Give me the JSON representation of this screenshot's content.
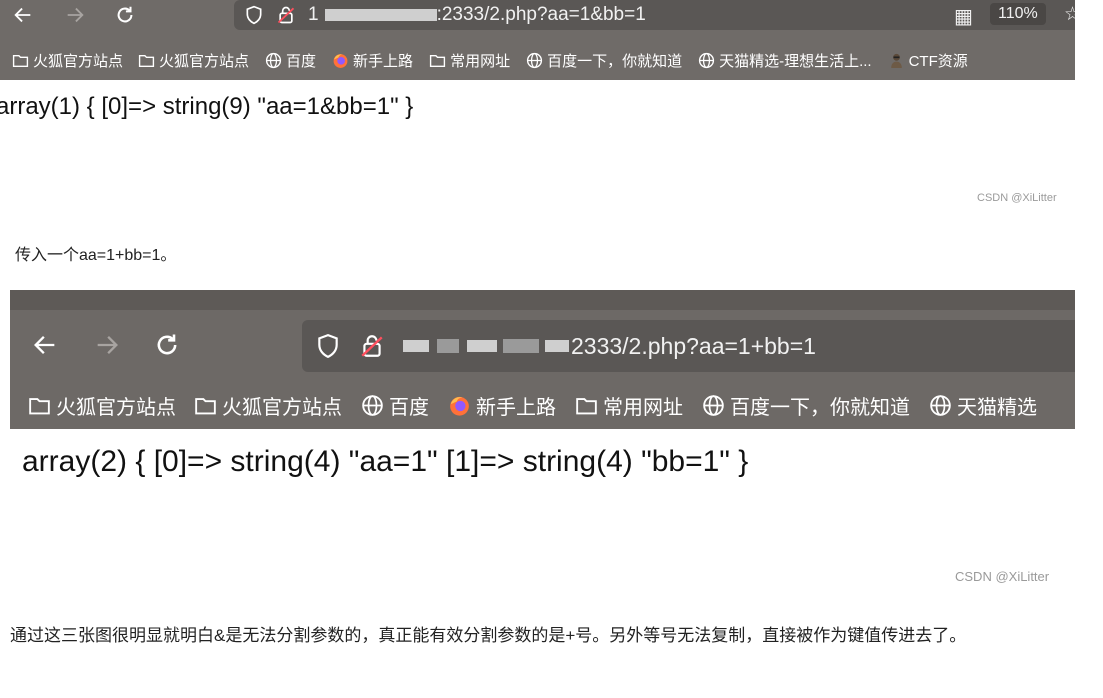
{
  "screenshot1": {
    "url_prefix": "1",
    "url_rest": ":2333/2.php?aa=1&bb=1",
    "zoom": "110%",
    "bookmarks": [
      {
        "icon": "folder-icon",
        "label": "火狐官方站点"
      },
      {
        "icon": "folder-icon",
        "label": "火狐官方站点"
      },
      {
        "icon": "globe-icon",
        "label": "百度"
      },
      {
        "icon": "firefox-icon",
        "label": "新手上路"
      },
      {
        "icon": "folder-icon",
        "label": "常用网址"
      },
      {
        "icon": "globe-icon",
        "label": "百度一下，你就知道"
      },
      {
        "icon": "globe-icon",
        "label": "天猫精选-理想生活上..."
      },
      {
        "icon": "hacker-icon",
        "label": "CTF资源"
      }
    ],
    "output": "array(1) { [0]=> string(9) \"aa=1&bb=1\" }",
    "watermark": "CSDN @XiLitter"
  },
  "caption1": "传入一个aa=1+bb=1。",
  "screenshot2": {
    "url_rest": "2333/2.php?aa=1+bb=1",
    "bookmarks": [
      {
        "icon": "folder-icon",
        "label": "火狐官方站点"
      },
      {
        "icon": "folder-icon",
        "label": "火狐官方站点"
      },
      {
        "icon": "globe-icon",
        "label": "百度"
      },
      {
        "icon": "firefox-icon",
        "label": "新手上路"
      },
      {
        "icon": "folder-icon",
        "label": "常用网址"
      },
      {
        "icon": "globe-icon",
        "label": "百度一下，你就知道"
      },
      {
        "icon": "globe-icon",
        "label": "天猫精选"
      }
    ],
    "output": "array(2) { [0]=> string(4) \"aa=1\" [1]=> string(4) \"bb=1\" }",
    "watermark": "CSDN @XiLitter"
  },
  "paragraph": "通过这三张图很明显就明白&是无法分割参数的，真正能有效分割参数的是+号。另外等号无法复制，直接被作为键值传进去了。"
}
